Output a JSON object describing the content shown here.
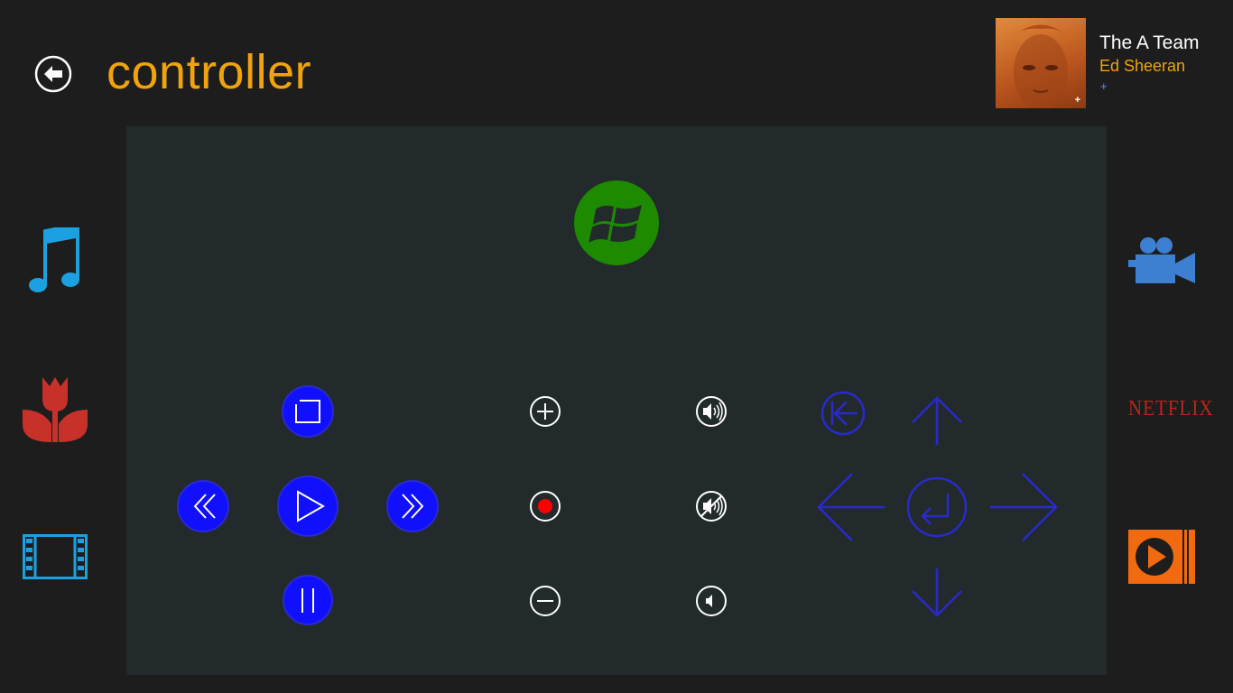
{
  "header": {
    "title": "controller",
    "back_icon": "back-arrow-icon"
  },
  "now_playing": {
    "song": "The A Team",
    "artist": "Ed Sheeran",
    "add_label": "+",
    "art_badge": "+"
  },
  "left_sidebar": [
    {
      "name": "music",
      "icon": "music-note-icon",
      "color": "#1ba1e2"
    },
    {
      "name": "pictures",
      "icon": "tulip-icon",
      "color": "#c8302a"
    },
    {
      "name": "videos",
      "icon": "film-strip-icon",
      "color": "#1ba1e2"
    }
  ],
  "right_sidebar": [
    {
      "name": "camera",
      "icon": "video-camera-icon",
      "color": "#3d7fd1"
    },
    {
      "name": "netflix",
      "label": "NETFLIX",
      "color": "#c0221c"
    },
    {
      "name": "media-player",
      "icon": "play-button-icon",
      "color": "#f26a0f"
    }
  ],
  "controls": {
    "windows_button": {
      "icon": "windows-logo-icon",
      "color": "#1e8a00"
    },
    "transport": [
      "stop",
      "rewind",
      "play",
      "fast-forward",
      "pause"
    ],
    "channel": [
      "channel-up",
      "record",
      "channel-down"
    ],
    "volume": [
      "volume-up",
      "mute",
      "volume-down"
    ],
    "navigation": [
      "back",
      "up",
      "left",
      "enter",
      "right",
      "down"
    ],
    "colors": {
      "transport": "#1010ff",
      "nav": "#2a2acc",
      "record": "#ff0000",
      "white": "#ffffff"
    }
  }
}
